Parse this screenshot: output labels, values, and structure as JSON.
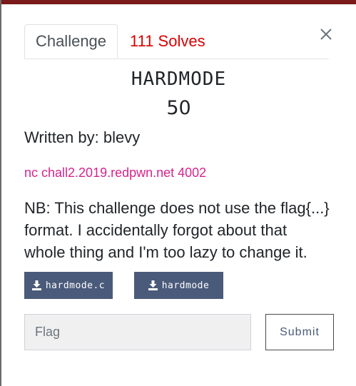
{
  "tabs": {
    "challenge": "Challenge",
    "solves": "111 Solves"
  },
  "challenge": {
    "name": "HARDMODE",
    "points": "50",
    "author": "Written by: blevy",
    "connection": "nc chall2.2019.redpwn.net 4002",
    "description": "NB: This challenge does not use the flag{...} format. I accidentally forgot about that whole thing and I'm too lazy to change it."
  },
  "files": [
    {
      "label": "hardmode.c",
      "icon": "download-icon"
    },
    {
      "label": "hardmode",
      "icon": "download-icon"
    }
  ],
  "form": {
    "flag_placeholder": "Flag",
    "submit_label": "Submit"
  },
  "colors": {
    "solves": "#d90000",
    "link": "#d6248c",
    "button": "#4a5a7a"
  }
}
